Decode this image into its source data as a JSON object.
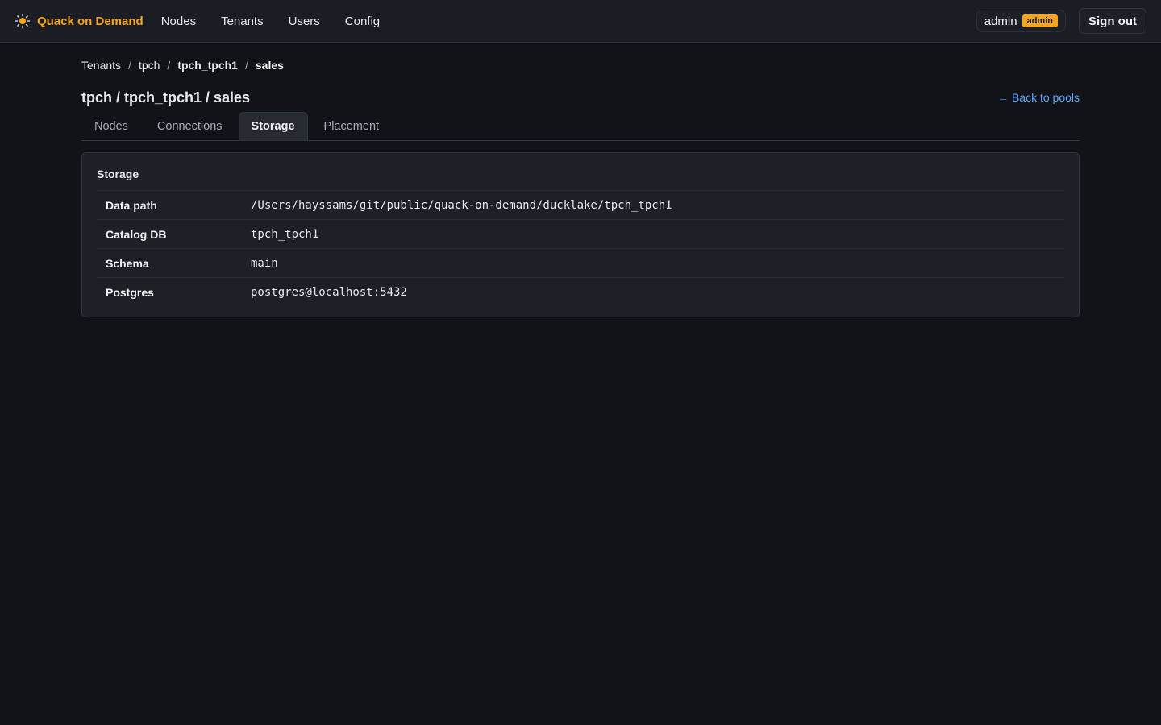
{
  "app": {
    "brand": "Quack on Demand",
    "brand_icon": "sun-icon",
    "accent_color": "#f5a623",
    "nav": [
      {
        "label": "Nodes"
      },
      {
        "label": "Tenants"
      },
      {
        "label": "Users"
      },
      {
        "label": "Config"
      }
    ],
    "user": {
      "name": "admin",
      "role": "admin"
    },
    "signout_label": "Sign out"
  },
  "breadcrumb": [
    {
      "label": "Tenants"
    },
    {
      "label": "tpch"
    },
    {
      "label": "tpch_tpch1"
    },
    {
      "label": "sales"
    }
  ],
  "breadcrumb_separator": "/",
  "page": {
    "title": "tpch / tpch_tpch1 / sales",
    "back_link": "← Back to pools",
    "link_color": "#58a6ff"
  },
  "tabs": [
    {
      "label": "Nodes",
      "active": false
    },
    {
      "label": "Connections",
      "active": false
    },
    {
      "label": "Storage",
      "active": true
    },
    {
      "label": "Placement",
      "active": false
    }
  ],
  "storage": {
    "title": "Storage",
    "rows": [
      {
        "key": "Data path",
        "value": "/Users/hayssams/git/public/quack-on-demand/ducklake/tpch_tpch1"
      },
      {
        "key": "Catalog DB",
        "value": "tpch_tpch1"
      },
      {
        "key": "Schema",
        "value": "main"
      },
      {
        "key": "Postgres",
        "value": "postgres@localhost:5432"
      }
    ]
  }
}
